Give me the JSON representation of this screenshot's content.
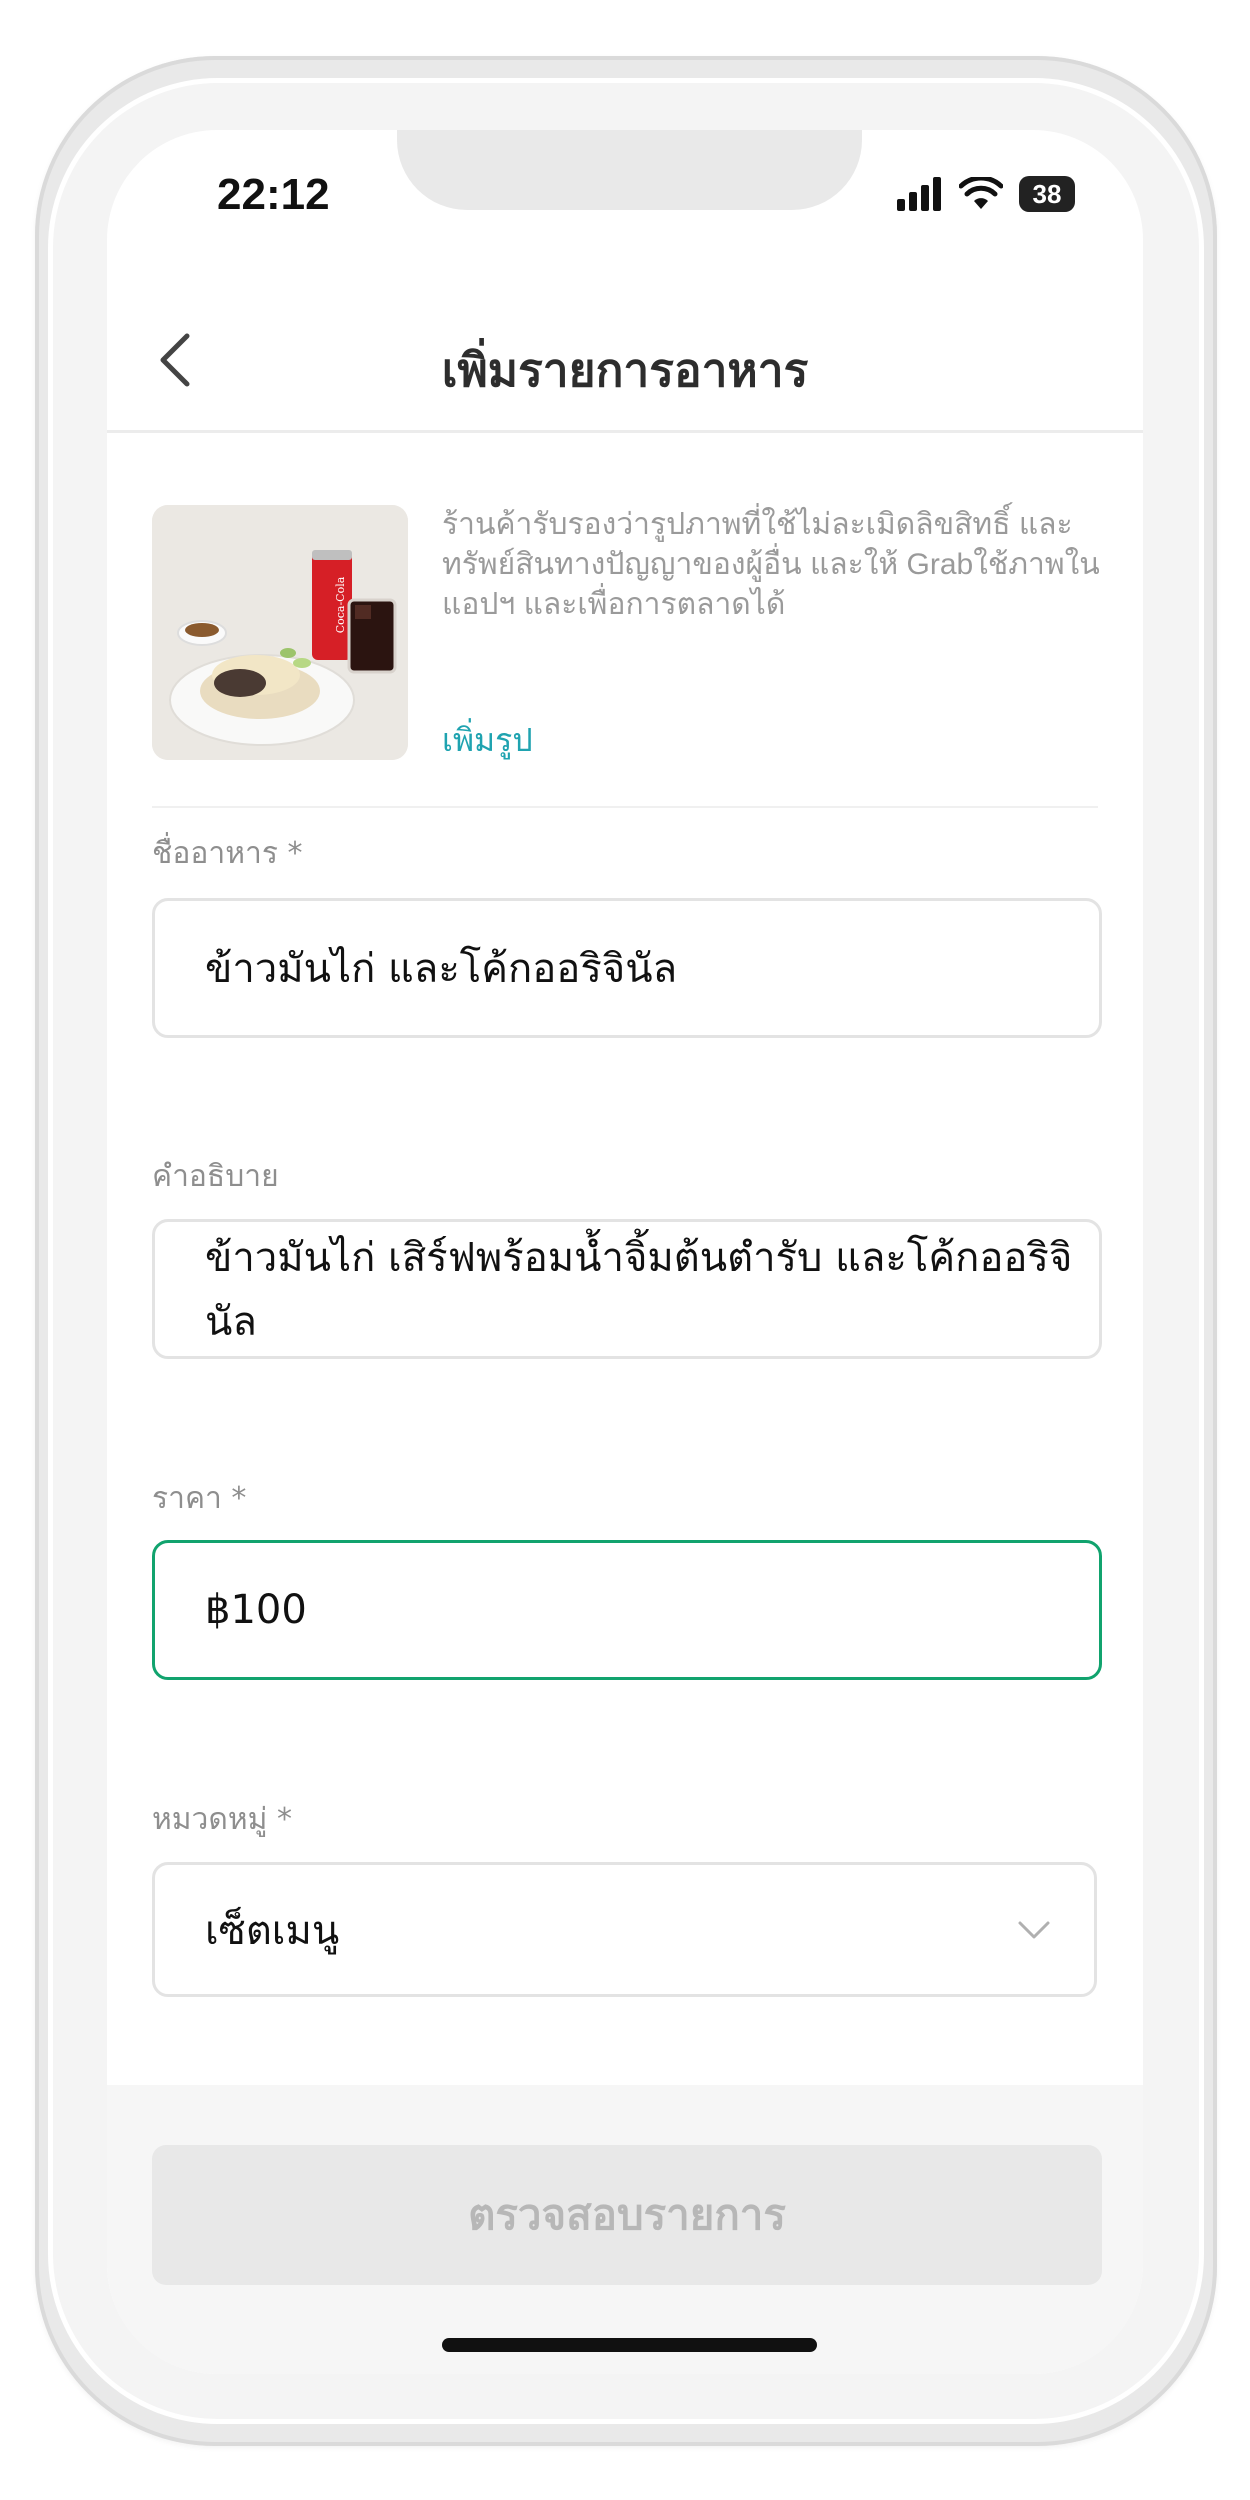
{
  "status_bar": {
    "time": "22:12",
    "battery": "38"
  },
  "header": {
    "title": "เพิ่มรายการอาหาร"
  },
  "photo": {
    "consent_text": "ร้านค้ารับรองว่ารูปภาพที่ใช้ไม่ละเมิดลิขสิทธิ์ และทรัพย์สินทางปัญญาของผู้อื่น และให้ Grabใช้ภาพในแอปฯ และเพื่อการตลาดได้",
    "add_label": "เพิ่มรูป",
    "can_label": "Coca-Cola"
  },
  "form": {
    "name": {
      "label": "ชื่ออาหาร *",
      "value": "ข้าวมันไก่ และโค้กออริจินัล"
    },
    "description": {
      "label": "คำอธิบาย",
      "value": "ข้าวมันไก่ เสิร์ฟพร้อมน้ำจิ้มต้นตำรับ และโค้กออริจินัล"
    },
    "price": {
      "label": "ราคา *",
      "value": "฿100"
    },
    "category": {
      "label": "หมวดหมู่ *",
      "value": "เซ็ตเมนู"
    }
  },
  "footer": {
    "submit_label": "ตรวจสอบรายการ"
  },
  "colors": {
    "accent_green": "#11a36e",
    "link_teal": "#1fa3b0",
    "disabled_text": "#b7b7b7"
  }
}
